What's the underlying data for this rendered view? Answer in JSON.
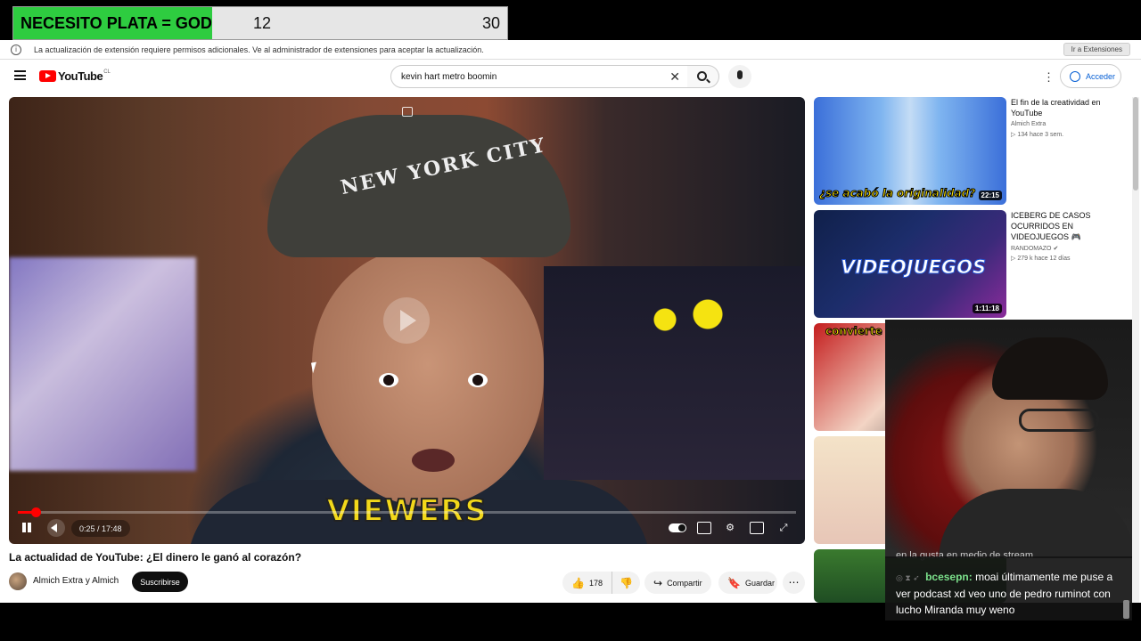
{
  "overlay": {
    "label": "NECESITO PLATA = GOD",
    "count": "12",
    "goal": "30",
    "accent_color": "#2ecc40"
  },
  "infobar": {
    "message": "La actualización de extensión requiere permisos adicionales. Ve al administrador de extensiones para aceptar la actualización.",
    "button_label": "Ir a Extensiones",
    "icon": "info-icon"
  },
  "header": {
    "logo_text": "YouTube",
    "logo_country": "CL",
    "search_value": "kevin hart metro boomin",
    "sign_in_label": "Acceder"
  },
  "player": {
    "caption": "VIEWERS",
    "current_time": "0:25",
    "duration": "17:48",
    "time_label": "0:25 / 17:48",
    "progress_fraction": 0.023,
    "state": "playing",
    "accent_color": "#ff0000",
    "thumbnail_caption": "NEW YORK CITY"
  },
  "video": {
    "title": "La actualidad de YouTube: ¿El dinero le ganó al corazón?",
    "channel": "Almich Extra y Almich",
    "subscribe_label": "Suscribirse",
    "likes": "178",
    "share_label": "Compartir",
    "save_label": "Guardar"
  },
  "recommendations": [
    {
      "title": "El fin de la creatividad en YouTube",
      "channel": "Almich Extra",
      "views": "134",
      "age": "hace 3 sem.",
      "duration": "22:15",
      "thumb_text": "¿se acabó la originalidad?"
    },
    {
      "title": "ICEBERG DE CASOS OCURRIDOS EN VIDEOJUEGOS 🎮",
      "channel": "RANDOMAZO",
      "views": "279 k",
      "age": "hace 12 días",
      "duration": "1:11:18",
      "thumb_text": "VIDEOJUEGOS"
    },
    {
      "thumb_text": "convierte"
    },
    {
      "thumb_text": ""
    },
    {
      "thumb_text": ""
    }
  ],
  "chat": {
    "prev_line": "en la gusta en medio de stream",
    "username": "bcesepn:",
    "message": "moai últimamente me puse a ver podcast xd veo uno de pedro ruminot con lucho Miranda muy weno"
  }
}
